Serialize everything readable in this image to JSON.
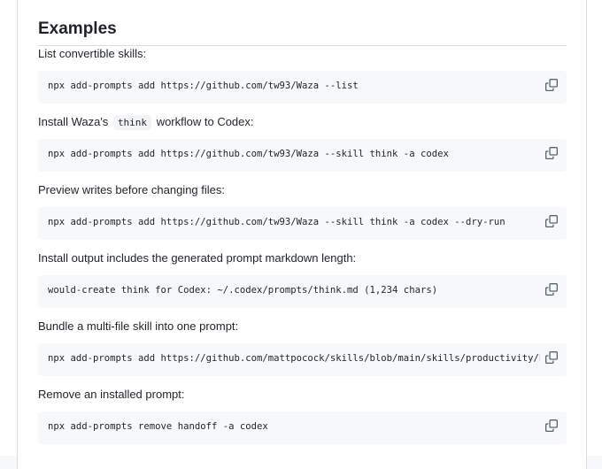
{
  "section_title": "Examples",
  "examples": [
    {
      "description": "List convertible skills:",
      "code": "npx add-prompts add https://github.com/tw93/Waza --list"
    },
    {
      "description_before": "Install Waza's",
      "description_code": "think",
      "description_after": "workflow to Codex:",
      "code": "npx add-prompts add https://github.com/tw93/Waza --skill think -a codex"
    },
    {
      "description": "Preview writes before changing files:",
      "code": "npx add-prompts add https://github.com/tw93/Waza --skill think -a codex --dry-run"
    },
    {
      "description": "Install output includes the generated prompt markdown length:",
      "code": "would-create think for Codex: ~/.codex/prompts/think.md (1,234 chars)"
    },
    {
      "description": "Bundle a multi-file skill into one prompt:",
      "code": "npx add-prompts add https://github.com/mattpocock/skills/blob/main/skills/productivity/handoff"
    },
    {
      "description": "Remove an installed prompt:",
      "code": "npx add-prompts remove handoff -a codex"
    }
  ],
  "icons": {
    "copy": "copy-icon"
  },
  "colors": {
    "text": "#1f2328",
    "code_background": "#f6f8fa",
    "border": "#d8dee4",
    "icon": "#59636e"
  }
}
